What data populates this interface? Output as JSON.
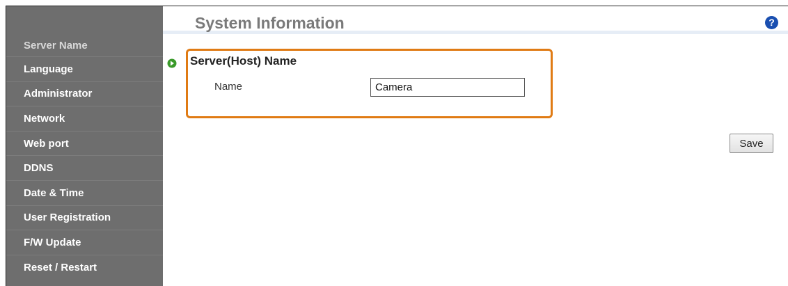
{
  "sidebar": {
    "items": [
      {
        "label": "Server Name"
      },
      {
        "label": "Language"
      },
      {
        "label": "Administrator"
      },
      {
        "label": "Network"
      },
      {
        "label": "Web port"
      },
      {
        "label": "DDNS"
      },
      {
        "label": "Date & Time"
      },
      {
        "label": "User Registration"
      },
      {
        "label": "F/W Update"
      },
      {
        "label": "Reset / Restart"
      }
    ]
  },
  "header": {
    "title": "System Information",
    "help_icon": "?"
  },
  "section": {
    "title": "Server(Host) Name",
    "field_label": "Name",
    "field_value": "Camera"
  },
  "actions": {
    "save_label": "Save"
  },
  "colors": {
    "sidebar_bg": "#6e6e6e",
    "highlight_border": "#e07b14",
    "bullet": "#3a9a2a",
    "help": "#1a4fb0"
  }
}
